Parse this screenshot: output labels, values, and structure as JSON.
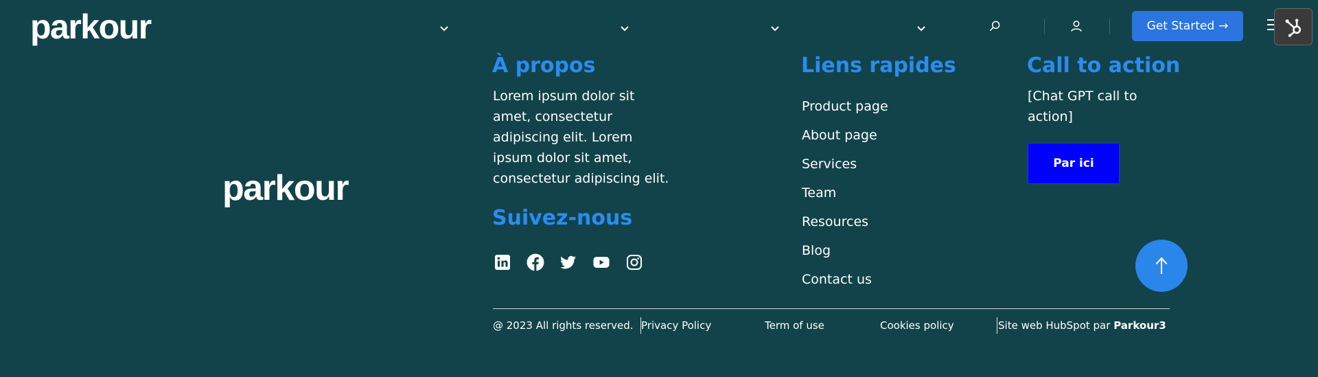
{
  "header": {
    "logo": "parkour",
    "nav_dropdowns": [
      "chevron-down-icon",
      "chevron-down-icon",
      "chevron-down-icon",
      "chevron-down-icon"
    ],
    "search_icon": "search-icon",
    "user_icon": "user-icon",
    "cta_label": "Get Started",
    "cta_arrow": "→",
    "menu_icon": "hamburger-icon",
    "badge_icon": "hubspot-sprocket-icon"
  },
  "footer": {
    "logo": "parkour",
    "about": {
      "title": "À propos",
      "text_lines": [
        "Lorem ipsum dolor sit",
        "amet, consectetur",
        "adipiscing elit. Lorem",
        "ipsum dolor sit amet,",
        "consectetur adipiscing elit."
      ]
    },
    "follow": {
      "title": "Suivez-nous",
      "icons": [
        "linkedin-icon",
        "facebook-icon",
        "twitter-icon",
        "youtube-icon",
        "instagram-icon"
      ]
    },
    "quick_links": {
      "title": "Liens rapides",
      "items": [
        "Product page",
        "About page",
        "Services",
        "Team",
        "Resources",
        "Blog",
        "Contact us"
      ]
    },
    "call_to_action": {
      "title": "Call to action",
      "text_lines": [
        "[Chat GPT call to",
        "action]"
      ],
      "button": "Par ici"
    },
    "scroll_top_icon": "arrow-up-icon",
    "bottom": {
      "copyright": "@ 2023 All rights reserved.",
      "privacy": "Privacy Policy",
      "terms": "Term of use",
      "cookies": "Cookies policy",
      "credit_prefix": "Site web HubSpot par",
      "credit_brand": "Parkour3"
    }
  },
  "colors": {
    "background": "#12434a",
    "accent_title": "#2a8cf0",
    "header_button": "#2c74df",
    "cta_button": "#0000ff",
    "scroll_button": "#2a86ea"
  }
}
